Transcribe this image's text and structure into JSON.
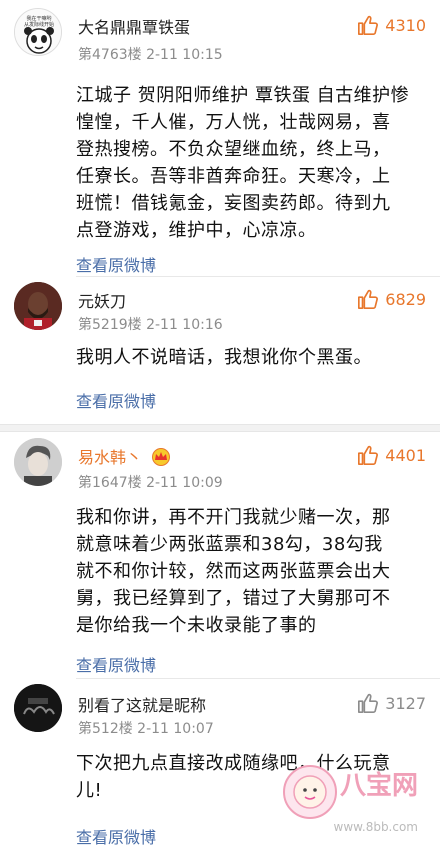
{
  "comments": [
    {
      "author": "大名鼎鼎覃铁蛋",
      "meta": "第4763楼  2-11 10:15",
      "likes": "4310",
      "avatar_text": "我在干嘛哟\n从发际线开始",
      "avatar_text_line1": "我在干嘛哟",
      "avatar_text_line2": "从发际线开始",
      "lines": [
        "江城子 贺阴阳师维护 覃铁蛋 自古维护惨",
        "惶惶，千人催，万人恍，壮哉网易，喜",
        "登热搜榜。不负众望继血统，终上马，",
        "任寮长。吾等非酋奔命狂。天寒冷，上",
        "班慌！借钱氪金，妄图卖药郎。待到九",
        "点登游戏，维护中，心凉凉。"
      ],
      "view_link": "查看原微博"
    },
    {
      "author": "元妖刀",
      "meta": "第5219楼  2-11 10:16",
      "likes": "6829",
      "lines": [
        "我明人不说暗话，我想讹你个黑蛋。"
      ],
      "view_link": "查看原微博"
    },
    {
      "author": "易水韩丶",
      "meta": "第1647楼  2-11 10:09",
      "likes": "4401",
      "lines": [
        "我和你讲，再不开门我就少赌一次，那",
        "就意味着少两张蓝票和38勾，38勾我",
        "就不和你计较，然而这两张蓝票会出大",
        "舅，我已经算到了，错过了大舅那可不",
        "是你给我一个未收录能了事的"
      ],
      "view_link": "查看原微博"
    },
    {
      "author": "别看了这就是昵称",
      "meta": "第512楼  2-11 10:07",
      "likes": "3127",
      "lines": [
        "下次把九点直接改成随缘吧，什么玩意",
        "儿!"
      ],
      "view_link": "查看原微博"
    }
  ],
  "watermark": {
    "logo_text": "八宝网",
    "url": "www.8bb.com"
  },
  "colors": {
    "accent": "#e8772c",
    "link": "#4a6ea8",
    "meta": "#8c8c8c"
  }
}
